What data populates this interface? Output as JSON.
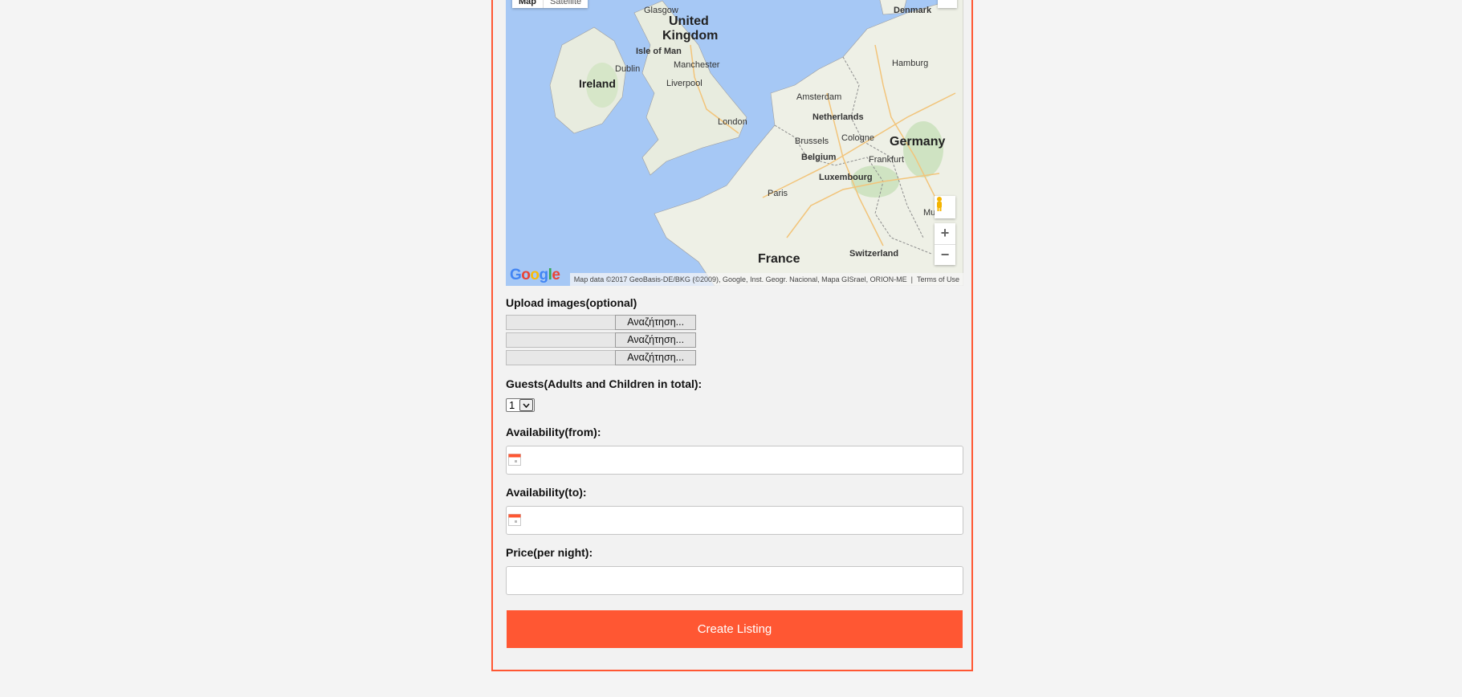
{
  "map": {
    "type_buttons": [
      "Map",
      "Satellite"
    ],
    "places": [
      {
        "name": "Glasgow"
      },
      {
        "name": "United"
      },
      {
        "name": "Kingdom"
      },
      {
        "name": "Isle of Man"
      },
      {
        "name": "Dublin"
      },
      {
        "name": "Ireland"
      },
      {
        "name": "Manchester"
      },
      {
        "name": "Liverpool"
      },
      {
        "name": "London"
      },
      {
        "name": "Denmark"
      },
      {
        "name": "Hamburg"
      },
      {
        "name": "Amsterdam"
      },
      {
        "name": "Netherlands"
      },
      {
        "name": "Brussels"
      },
      {
        "name": "Cologne"
      },
      {
        "name": "Germany"
      },
      {
        "name": "Belgium"
      },
      {
        "name": "Frankfurt"
      },
      {
        "name": "Luxembourg"
      },
      {
        "name": "Paris"
      },
      {
        "name": "France"
      },
      {
        "name": "Switzerland"
      },
      {
        "name": "Munich"
      }
    ],
    "zoom_in": "+",
    "zoom_out": "−",
    "attribution": "Map data ©2017 GeoBasis-DE/BKG (©2009), Google, Inst. Geogr. Nacional, Mapa GISrael, ORION-ME",
    "terms": "Terms of Use",
    "logo": "Google"
  },
  "upload": {
    "label": "Upload images(optional)",
    "browse_label": "Αναζήτηση...",
    "count": 3
  },
  "guests": {
    "label": "Guests(Adults and Children in total):",
    "selected": "1"
  },
  "availability_from": {
    "label": "Availability(from):",
    "value": ""
  },
  "availability_to": {
    "label": "Availability(to):",
    "value": ""
  },
  "price": {
    "label": "Price(per night):",
    "value": ""
  },
  "submit": {
    "label": "Create Listing"
  },
  "colors": {
    "accent": "#ff5733",
    "water": "#a6c8f5",
    "land": "#eef0e6"
  }
}
